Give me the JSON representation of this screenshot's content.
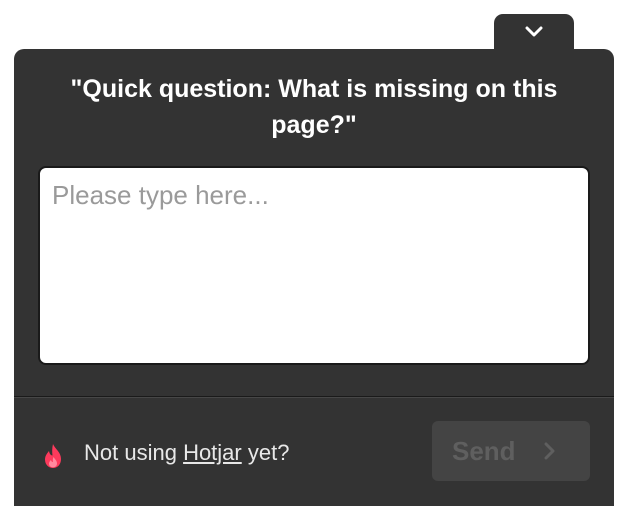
{
  "widget": {
    "collapse_icon": "chevron-down-icon",
    "question": "\"Quick question: What is missing on this page?\"",
    "answer": {
      "value": "",
      "placeholder": "Please type here..."
    },
    "footer": {
      "brand_icon": "hotjar-flame-icon",
      "promo_prefix": "Not using ",
      "promo_link": "Hotjar",
      "promo_suffix": " yet?",
      "send_label": "Send",
      "send_icon": "chevron-right-icon"
    }
  },
  "colors": {
    "panel": "#333333",
    "brand_flame": "#fd3a5c",
    "send_disabled_bg": "#444444",
    "send_disabled_text": "#5f5f5f"
  }
}
